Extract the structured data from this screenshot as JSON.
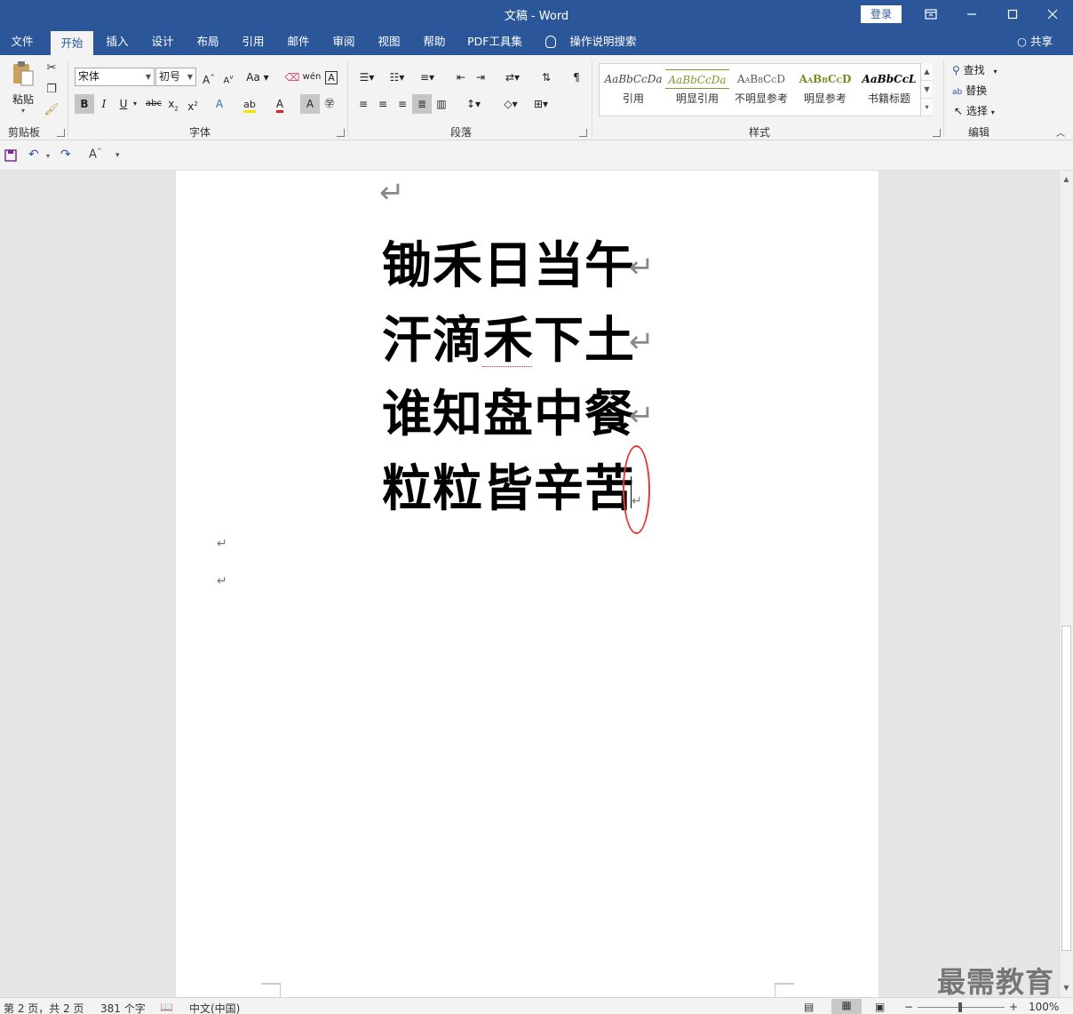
{
  "app": {
    "title": "文稿 - Word",
    "login_label": "登录",
    "share_label": "共享"
  },
  "tabs": [
    {
      "label": "文件"
    },
    {
      "label": "开始",
      "active": true
    },
    {
      "label": "插入"
    },
    {
      "label": "设计"
    },
    {
      "label": "布局"
    },
    {
      "label": "引用"
    },
    {
      "label": "邮件"
    },
    {
      "label": "审阅"
    },
    {
      "label": "视图"
    },
    {
      "label": "帮助"
    },
    {
      "label": "PDF工具集"
    },
    {
      "label": "操作说明搜索"
    }
  ],
  "ribbon": {
    "clipboard": {
      "group": "剪贴板",
      "paste": "粘贴"
    },
    "font": {
      "group": "字体",
      "font_name": "宋体",
      "font_size": "初号",
      "change_case": "Aa"
    },
    "paragraph": {
      "group": "段落"
    },
    "styles": {
      "group": "样式",
      "items": [
        {
          "sample": "AaBbCcDa",
          "name": "引用",
          "color": "#444444"
        },
        {
          "sample": "AaBbCcDa",
          "name": "明显引用",
          "color": "#7a9a2e"
        },
        {
          "sample": "AaBbCcD",
          "name": "不明显参考",
          "color": "#555555"
        },
        {
          "sample": "AaBbCcD",
          "name": "明显参考",
          "color": "#6f8f1f"
        },
        {
          "sample": "AaBbCcL",
          "name": "书籍标题",
          "color": "#000000"
        }
      ]
    },
    "editing": {
      "group": "编辑",
      "find": "查找",
      "replace": "替换",
      "select": "选择"
    }
  },
  "document": {
    "lines": [
      "锄禾日当午",
      "汗滴禾下土",
      "谁知盘中餐",
      "粒粒皆辛苦"
    ]
  },
  "status": {
    "page": "第 2 页，共 2 页",
    "words": "381 个字",
    "language": "中文(中国)",
    "zoom": "100%"
  },
  "watermark": "最需教育",
  "colors": {
    "brand": "#2b579a",
    "annotation": "#e53935"
  }
}
